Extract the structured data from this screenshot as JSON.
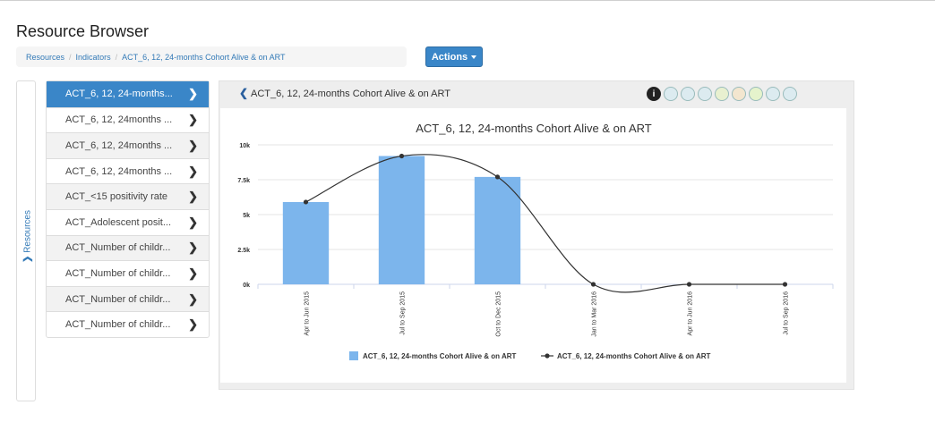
{
  "page_title": "Resource Browser",
  "breadcrumb": [
    "Resources",
    "Indicators",
    "ACT_6, 12, 24-months Cohort Alive & on ART"
  ],
  "actions_label": "Actions",
  "resources_tab_label": "Resources",
  "list_items": [
    "ACT_6, 12, 24-months...",
    "ACT_6, 12, 24months ...",
    "ACT_6, 12, 24months ...",
    "ACT_6, 12, 24months ...",
    "ACT_<15 positivity rate",
    "ACT_Adolescent posit...",
    "ACT_Number of childr...",
    "ACT_Number of childr...",
    "ACT_Number of childr...",
    "ACT_Number of childr..."
  ],
  "panel_title": "ACT_6, 12, 24-months Cohort Alive & on ART",
  "toolbar_icons": [
    "info-icon",
    "table-icon",
    "pivot-icon",
    "column-icon",
    "bar-icon",
    "line-icon",
    "pie-icon",
    "area-icon",
    "list-icon"
  ],
  "colors": {
    "bar": "#7cb5ec",
    "line": "#333333",
    "active": "#3a86c8"
  },
  "chart_data": {
    "type": "bar",
    "title": "ACT_6, 12, 24-months Cohort Alive & on ART",
    "categories": [
      "Apr to Jun 2015",
      "Jul to Sep 2015",
      "Oct to Dec 2015",
      "Jan to Mar 2016",
      "Apr to Jun 2016",
      "Jul to Sep 2016"
    ],
    "y_ticks": [
      "0k",
      "2.5k",
      "5k",
      "7.5k",
      "10k"
    ],
    "ylim": [
      0,
      10000
    ],
    "series": [
      {
        "name": "ACT_6, 12, 24-months Cohort Alive & on ART",
        "type": "bar",
        "values": [
          5900,
          9200,
          7700,
          0,
          0,
          0
        ]
      },
      {
        "name": "ACT_6, 12, 24-months Cohort Alive & on ART",
        "type": "line",
        "values": [
          5900,
          9200,
          7700,
          0,
          0,
          0
        ]
      }
    ],
    "legend_position": "bottom"
  }
}
